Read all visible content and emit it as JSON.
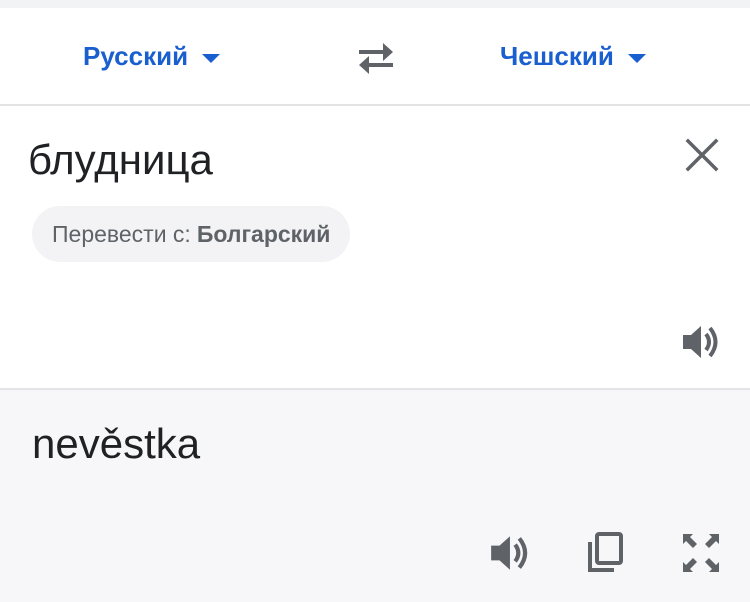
{
  "language_bar": {
    "source_language": "Русский",
    "target_language": "Чешский",
    "swap_icon": "swap-horiz-icon",
    "dropdown_icon": "caret-down-icon"
  },
  "input": {
    "text": "блудница",
    "clear_icon": "close-icon",
    "detected_prefix": "Перевести с:",
    "detected_language": "Болгарский",
    "speaker_icon": "volume-icon"
  },
  "output": {
    "text": "nevěstka",
    "actions": [
      "volume-icon",
      "copy-icon",
      "fullscreen-icon"
    ]
  },
  "colors": {
    "accent": "#1a5fd0",
    "icon": "#5f6368",
    "output_background": "#f7f7fa"
  }
}
